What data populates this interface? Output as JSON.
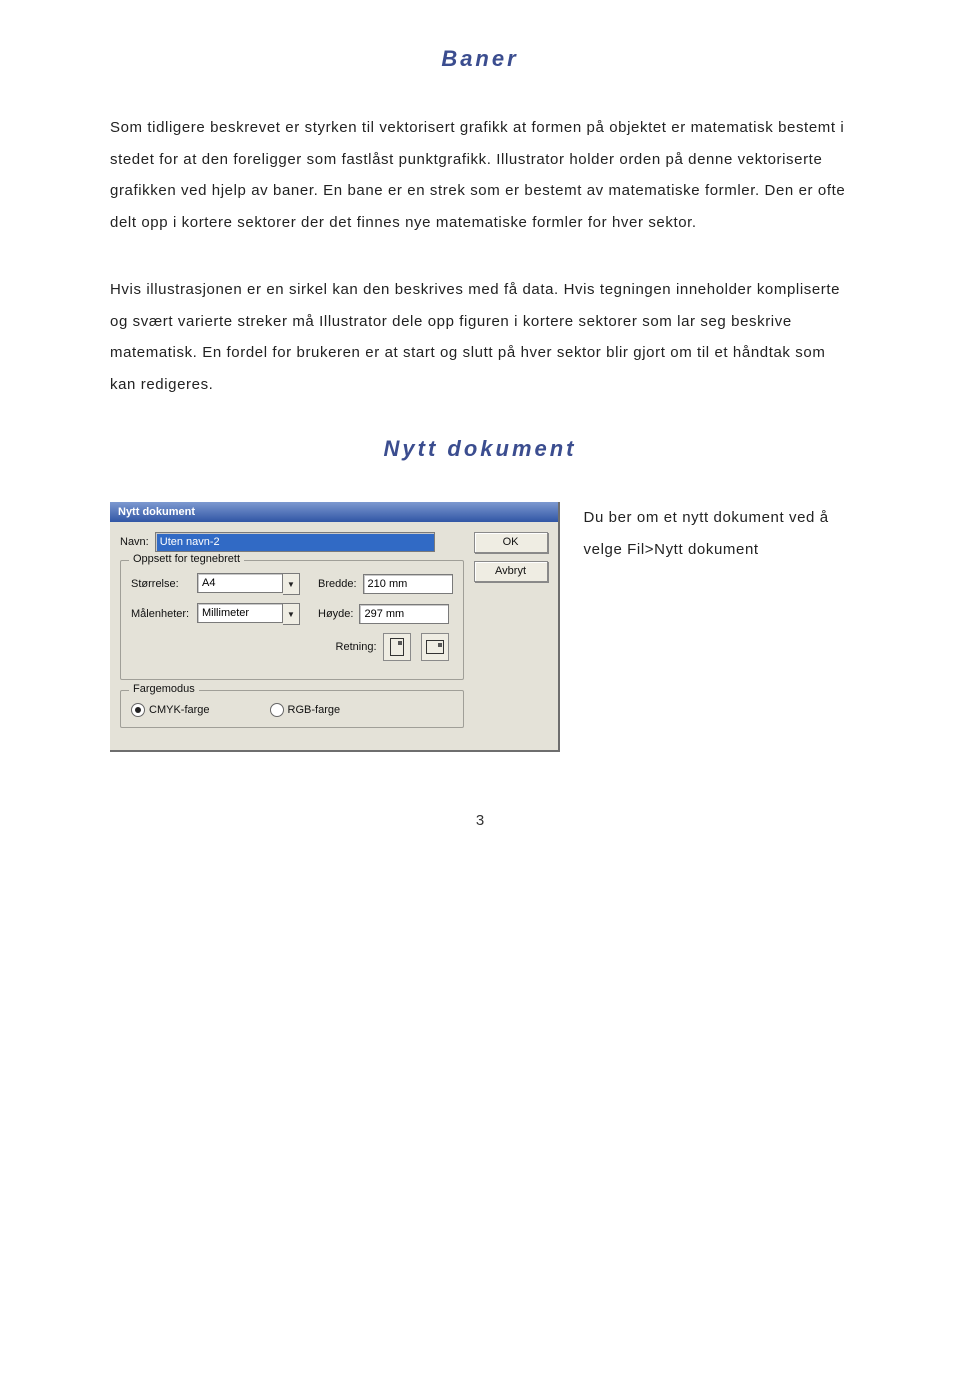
{
  "headings": {
    "baner": "Baner",
    "nytt_dokument": "Nytt dokument"
  },
  "paragraphs": {
    "p1": "Som tidligere beskrevet er styrken til vektorisert grafikk at formen på objektet er matematisk bestemt i stedet for at den foreligger som fastlåst punktgrafikk. Illustrator holder orden på denne vektoriserte grafikken ved hjelp av baner. En bane er en strek som er bestemt av matematiske formler. Den er ofte delt opp i kortere sektorer der det finnes nye matematiske formler for hver sektor.",
    "p2": "Hvis illustrasjonen er en sirkel kan den beskrives med få data. Hvis tegningen inneholder kompliserte og svært varierte streker må Illustrator dele opp figuren i kortere sektorer som lar seg beskrive matematisk. En fordel for brukeren er at start og slutt på hver sektor blir gjort om til et håndtak som kan redigeres.",
    "side1": "Du ber om et nytt dokument ved å velge Fil>Nytt dokument"
  },
  "dialog": {
    "title": "Nytt dokument",
    "name_label": "Navn:",
    "name_value": "Uten navn-2",
    "ok": "OK",
    "cancel": "Avbryt",
    "artboard_legend": "Oppsett for tegnebrett",
    "size_label": "Størrelse:",
    "size_value": "A4",
    "width_label": "Bredde:",
    "width_value": "210 mm",
    "units_label": "Målenheter:",
    "units_value": "Millimeter",
    "height_label": "Høyde:",
    "height_value": "297 mm",
    "orientation_label": "Retning:",
    "colormode_legend": "Fargemodus",
    "cmyk_label": "CMYK-farge",
    "rgb_label": "RGB-farge"
  },
  "page_number": "3"
}
